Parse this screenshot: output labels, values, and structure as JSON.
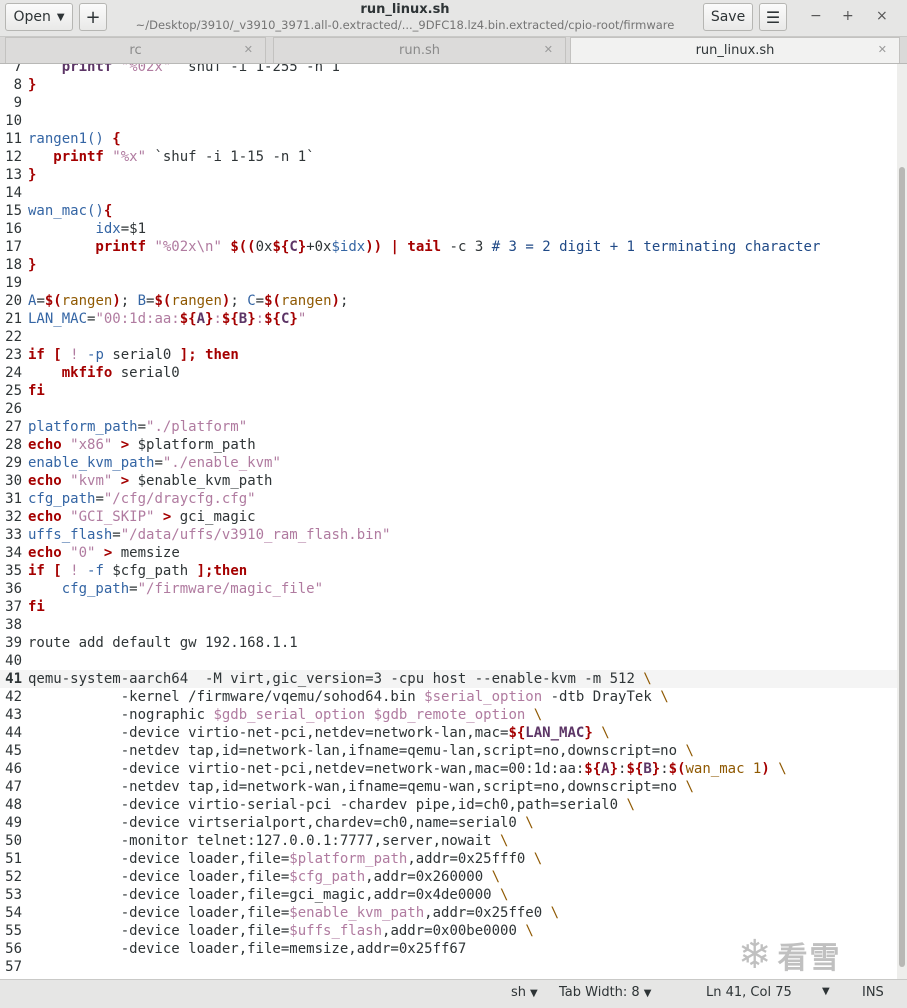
{
  "header": {
    "open_label": "Open",
    "new_label": "+",
    "title": "run_linux.sh",
    "subtitle": "~/Desktop/3910/_v3910_3971.all-0.extracted/..._9DFC18.lz4.bin.extracted/cpio-root/firmware",
    "save_label": "Save",
    "menu_icon": "hamburger-menu-icon",
    "minimize_glyph": "−",
    "maximize_glyph": "+",
    "close_glyph": "×"
  },
  "tabs": [
    {
      "label": "rc",
      "active": false
    },
    {
      "label": "run.sh",
      "active": false
    },
    {
      "label": "run_linux.sh",
      "active": true
    }
  ],
  "editor": {
    "current_line": 41,
    "lines": [
      {
        "n": "7",
        "t": [
          [
            "fn",
            "    printf "
          ],
          [
            "str",
            "\"%02x\""
          ],
          [
            "txt",
            " `shuf -i 1-255 -n 1`"
          ]
        ]
      },
      {
        "n": "8",
        "t": [
          [
            "kw",
            "}"
          ]
        ]
      },
      {
        "n": "9",
        "t": []
      },
      {
        "n": "10",
        "t": []
      },
      {
        "n": "11",
        "t": [
          [
            "func",
            "rangen1() "
          ],
          [
            "kw",
            "{"
          ]
        ]
      },
      {
        "n": "12",
        "t": [
          [
            "kw",
            "   printf "
          ],
          [
            "str",
            "\"%x\""
          ],
          [
            "txt",
            " `shuf -i 1-15 -n 1`"
          ]
        ]
      },
      {
        "n": "13",
        "t": [
          [
            "kw",
            "}"
          ]
        ]
      },
      {
        "n": "14",
        "t": []
      },
      {
        "n": "15",
        "t": [
          [
            "func",
            "wan_mac()"
          ],
          [
            "kw",
            "{"
          ]
        ]
      },
      {
        "n": "16",
        "t": [
          [
            "txt",
            "        "
          ],
          [
            "func",
            "idx"
          ],
          [
            "txt",
            "=$1"
          ]
        ]
      },
      {
        "n": "17",
        "t": [
          [
            "kw",
            "        printf "
          ],
          [
            "str",
            "\"%02x\\n\""
          ],
          [
            "txt",
            " "
          ],
          [
            "kw",
            "$(("
          ],
          [
            "txt",
            "0x"
          ],
          [
            "kw",
            "${"
          ],
          [
            "fn",
            "C"
          ],
          [
            "kw",
            "}"
          ],
          [
            "txt",
            "+0x"
          ],
          [
            "vid",
            "$idx"
          ],
          [
            "kw",
            "))"
          ],
          [
            "txt",
            " "
          ],
          [
            "kw",
            "|"
          ],
          [
            "txt",
            " "
          ],
          [
            "kw",
            "tail"
          ],
          [
            "txt",
            " -c 3 "
          ],
          [
            "cmt",
            "# 3 = 2 digit + 1 terminating character"
          ]
        ]
      },
      {
        "n": "18",
        "t": [
          [
            "kw",
            "}"
          ]
        ]
      },
      {
        "n": "19",
        "t": []
      },
      {
        "n": "20",
        "t": [
          [
            "vid",
            "A"
          ],
          [
            "txt",
            "="
          ],
          [
            "kw",
            "$("
          ],
          [
            "param",
            "rangen"
          ],
          [
            "kw",
            ")"
          ],
          [
            "txt",
            "; "
          ],
          [
            "vid",
            "B"
          ],
          [
            "txt",
            "="
          ],
          [
            "kw",
            "$("
          ],
          [
            "param",
            "rangen"
          ],
          [
            "kw",
            ")"
          ],
          [
            "txt",
            "; "
          ],
          [
            "vid",
            "C"
          ],
          [
            "txt",
            "="
          ],
          [
            "kw",
            "$("
          ],
          [
            "param",
            "rangen"
          ],
          [
            "kw",
            ")"
          ],
          [
            "txt",
            ";"
          ]
        ]
      },
      {
        "n": "21",
        "t": [
          [
            "vid",
            "LAN_MAC"
          ],
          [
            "txt",
            "="
          ],
          [
            "str",
            "\"00:1d:aa:"
          ],
          [
            "kw",
            "${"
          ],
          [
            "fn",
            "A"
          ],
          [
            "kw",
            "}"
          ],
          [
            "str",
            ":"
          ],
          [
            "kw",
            "${"
          ],
          [
            "fn",
            "B"
          ],
          [
            "kw",
            "}"
          ],
          [
            "str",
            ":"
          ],
          [
            "kw",
            "${"
          ],
          [
            "fn",
            "C"
          ],
          [
            "kw",
            "}"
          ],
          [
            "str",
            "\""
          ]
        ]
      },
      {
        "n": "22",
        "t": []
      },
      {
        "n": "23",
        "t": [
          [
            "kw",
            "if"
          ],
          [
            "txt",
            " "
          ],
          [
            "kw",
            "["
          ],
          [
            "txt",
            " "
          ],
          [
            "str",
            "!"
          ],
          [
            "txt",
            " "
          ],
          [
            "vid",
            "-p"
          ],
          [
            "txt",
            " serial0 "
          ],
          [
            "kw",
            "];"
          ],
          [
            "txt",
            " "
          ],
          [
            "kw",
            "then"
          ]
        ]
      },
      {
        "n": "24",
        "t": [
          [
            "txt",
            "    "
          ],
          [
            "kw",
            "mkfifo"
          ],
          [
            "txt",
            " serial0"
          ]
        ]
      },
      {
        "n": "25",
        "t": [
          [
            "kw",
            "fi"
          ]
        ]
      },
      {
        "n": "26",
        "t": []
      },
      {
        "n": "27",
        "t": [
          [
            "vid",
            "platform_path"
          ],
          [
            "txt",
            "="
          ],
          [
            "str",
            "\"./platform\""
          ]
        ]
      },
      {
        "n": "28",
        "t": [
          [
            "kw",
            "echo"
          ],
          [
            "txt",
            " "
          ],
          [
            "str",
            "\"x86\""
          ],
          [
            "txt",
            " "
          ],
          [
            "kw",
            ">"
          ],
          [
            "txt",
            " $platform_path"
          ]
        ]
      },
      {
        "n": "29",
        "t": [
          [
            "vid",
            "enable_kvm_path"
          ],
          [
            "txt",
            "="
          ],
          [
            "str",
            "\"./enable_kvm\""
          ]
        ]
      },
      {
        "n": "30",
        "t": [
          [
            "kw",
            "echo"
          ],
          [
            "txt",
            " "
          ],
          [
            "str",
            "\"kvm\""
          ],
          [
            "txt",
            " "
          ],
          [
            "kw",
            ">"
          ],
          [
            "txt",
            " $enable_kvm_path"
          ]
        ]
      },
      {
        "n": "31",
        "t": [
          [
            "vid",
            "cfg_path"
          ],
          [
            "txt",
            "="
          ],
          [
            "str",
            "\"/cfg/draycfg.cfg\""
          ]
        ]
      },
      {
        "n": "32",
        "t": [
          [
            "kw",
            "echo"
          ],
          [
            "txt",
            " "
          ],
          [
            "str",
            "\"GCI_SKIP\""
          ],
          [
            "txt",
            " "
          ],
          [
            "kw",
            ">"
          ],
          [
            "txt",
            " gci_magic"
          ]
        ]
      },
      {
        "n": "33",
        "t": [
          [
            "vid",
            "uffs_flash"
          ],
          [
            "txt",
            "="
          ],
          [
            "str",
            "\"/data/uffs/v3910_ram_flash.bin\""
          ]
        ]
      },
      {
        "n": "34",
        "t": [
          [
            "kw",
            "echo"
          ],
          [
            "txt",
            " "
          ],
          [
            "str",
            "\"0\""
          ],
          [
            "txt",
            " "
          ],
          [
            "kw",
            ">"
          ],
          [
            "txt",
            " memsize"
          ]
        ]
      },
      {
        "n": "35",
        "t": [
          [
            "kw",
            "if"
          ],
          [
            "txt",
            " "
          ],
          [
            "kw",
            "["
          ],
          [
            "txt",
            " "
          ],
          [
            "str",
            "!"
          ],
          [
            "txt",
            " "
          ],
          [
            "vid",
            "-f"
          ],
          [
            "txt",
            " $cfg_path "
          ],
          [
            "kw",
            "];then"
          ]
        ]
      },
      {
        "n": "36",
        "t": [
          [
            "txt",
            "    "
          ],
          [
            "vid",
            "cfg_path"
          ],
          [
            "txt",
            "="
          ],
          [
            "str",
            "\"/firmware/magic_file\""
          ]
        ]
      },
      {
        "n": "37",
        "t": [
          [
            "kw",
            "fi"
          ]
        ]
      },
      {
        "n": "38",
        "t": []
      },
      {
        "n": "39",
        "t": [
          [
            "txt",
            "route add default gw 192.168.1.1"
          ]
        ]
      },
      {
        "n": "40",
        "t": []
      },
      {
        "n": "41",
        "t": [
          [
            "txt",
            "qemu-system-aarch64  -M virt,gic_version=3 -cpu host --enable-kvm -m 512 "
          ],
          [
            "param",
            "\\"
          ]
        ]
      },
      {
        "n": "42",
        "t": [
          [
            "txt",
            "           -kernel /firmware/vqemu/sohod64.bin "
          ],
          [
            "str",
            "$serial_option"
          ],
          [
            "txt",
            " -dtb DrayTek "
          ],
          [
            "param",
            "\\"
          ]
        ]
      },
      {
        "n": "43",
        "t": [
          [
            "txt",
            "           -nographic "
          ],
          [
            "str",
            "$gdb_serial_option"
          ],
          [
            "txt",
            " "
          ],
          [
            "str",
            "$gdb_remote_option"
          ],
          [
            "txt",
            " "
          ],
          [
            "param",
            "\\"
          ]
        ]
      },
      {
        "n": "44",
        "t": [
          [
            "txt",
            "           -device virtio-net-pci,netdev=network-lan,mac="
          ],
          [
            "kw",
            "${"
          ],
          [
            "fn",
            "LAN_MAC"
          ],
          [
            "kw",
            "}"
          ],
          [
            "txt",
            " "
          ],
          [
            "param",
            "\\"
          ]
        ]
      },
      {
        "n": "45",
        "t": [
          [
            "txt",
            "           -netdev tap,id=network-lan,ifname=qemu-lan,script=no,downscript=no "
          ],
          [
            "param",
            "\\"
          ]
        ]
      },
      {
        "n": "46",
        "t": [
          [
            "txt",
            "           -device virtio-net-pci,netdev=network-wan,mac=00:1d:aa:"
          ],
          [
            "kw",
            "${"
          ],
          [
            "fn",
            "A"
          ],
          [
            "kw",
            "}"
          ],
          [
            "txt",
            ":"
          ],
          [
            "kw",
            "${"
          ],
          [
            "fn",
            "B"
          ],
          [
            "kw",
            "}"
          ],
          [
            "txt",
            ":"
          ],
          [
            "kw",
            "$("
          ],
          [
            "param",
            "wan_mac 1"
          ],
          [
            "kw",
            ")"
          ],
          [
            "txt",
            " "
          ],
          [
            "param",
            "\\"
          ]
        ]
      },
      {
        "n": "47",
        "t": [
          [
            "txt",
            "           -netdev tap,id=network-wan,ifname=qemu-wan,script=no,downscript=no "
          ],
          [
            "param",
            "\\"
          ]
        ]
      },
      {
        "n": "48",
        "t": [
          [
            "txt",
            "           -device virtio-serial-pci -chardev pipe,id=ch0,path=serial0 "
          ],
          [
            "param",
            "\\"
          ]
        ]
      },
      {
        "n": "49",
        "t": [
          [
            "txt",
            "           -device virtserialport,chardev=ch0,name=serial0 "
          ],
          [
            "param",
            "\\"
          ]
        ]
      },
      {
        "n": "50",
        "t": [
          [
            "txt",
            "           -monitor telnet:127.0.0.1:7777,server,nowait "
          ],
          [
            "param",
            "\\"
          ]
        ]
      },
      {
        "n": "51",
        "t": [
          [
            "txt",
            "           -device loader,file="
          ],
          [
            "str",
            "$platform_path"
          ],
          [
            "txt",
            ",addr=0x25fff0 "
          ],
          [
            "param",
            "\\"
          ]
        ]
      },
      {
        "n": "52",
        "t": [
          [
            "txt",
            "           -device loader,file="
          ],
          [
            "str",
            "$cfg_path"
          ],
          [
            "txt",
            ",addr=0x260000 "
          ],
          [
            "param",
            "\\"
          ]
        ]
      },
      {
        "n": "53",
        "t": [
          [
            "txt",
            "           -device loader,file=gci_magic,addr=0x4de0000 "
          ],
          [
            "param",
            "\\"
          ]
        ]
      },
      {
        "n": "54",
        "t": [
          [
            "txt",
            "           -device loader,file="
          ],
          [
            "str",
            "$enable_kvm_path"
          ],
          [
            "txt",
            ",addr=0x25ffe0 "
          ],
          [
            "param",
            "\\"
          ]
        ]
      },
      {
        "n": "55",
        "t": [
          [
            "txt",
            "           -device loader,file="
          ],
          [
            "str",
            "$uffs_flash"
          ],
          [
            "txt",
            ",addr=0x00be0000 "
          ],
          [
            "param",
            "\\"
          ]
        ]
      },
      {
        "n": "56",
        "t": [
          [
            "txt",
            "           -device loader,file=memsize,addr=0x25ff67"
          ]
        ]
      },
      {
        "n": "57",
        "t": []
      }
    ]
  },
  "status": {
    "language": "sh",
    "tab_width": "Tab Width: 8",
    "position": "Ln 41, Col 75",
    "mode": "INS"
  },
  "watermark": {
    "flake": "❄",
    "text": "看雪"
  },
  "colors": {
    "keyword": "#a40000",
    "variable": "#3465a4",
    "string": "#b07ba0",
    "param": "#8f5902",
    "highlight": "#5c3566"
  }
}
